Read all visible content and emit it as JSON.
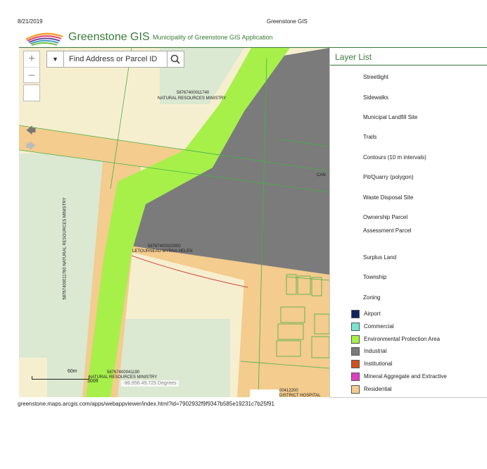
{
  "print": {
    "date": "8/21/2019",
    "title": "Greenstone GIS",
    "url": "greenstone.maps.arcgis.com/apps/webappviewer/index.html?id=7902932f9f9347b585e19231c7b25f91"
  },
  "header": {
    "app_name": "Greenstone GIS",
    "subtitle": "Municipality of Greenstone GIS Application"
  },
  "map": {
    "zoom_in_label": "+",
    "zoom_out_label": "–",
    "back_label": "🡄",
    "forward_label": "🡆",
    "search_placeholder": "Find Address or Parcel ID",
    "labels": {
      "parcel_top_id": "58767400011740",
      "parcel_top_owner": "NATURAL RESOURCES MINISTRY",
      "parcel_left": "58767400011760 NATURAL RESOURCES MINISTRY",
      "parcel_mid_id": "58767400020000",
      "parcel_mid_owner": "LETOURNEAU MYRNA HELEN",
      "parcel_bottom_id": "58767400041190",
      "parcel_bottom_owner": "NATURAL RESOURCES MINISTRY",
      "parcel_br_id": "00412200",
      "parcel_br_owner": "DISTRICT HOSPITAL",
      "canv": "CAN"
    },
    "scale_m": "60m",
    "scale_ft": "300ft",
    "coordinates": "-86.956 49.725 Degrees"
  },
  "layer_list": {
    "title": "Layer List",
    "layers": [
      "Streetlight",
      "Sidewalks",
      "Municipal Landfill Site",
      "Trails",
      "Contours (10 m intervals)",
      "Pit/Quarry (polygon)",
      "Waste Disposal Site",
      "Ownership Parcel",
      "Assessment Parcel",
      "Surplus Land",
      "Township",
      "Zoning"
    ],
    "legend": [
      {
        "label": "Airport",
        "color": "#0f2160"
      },
      {
        "label": "Commercial",
        "color": "#79e3d1"
      },
      {
        "label": "Environmental Protection Area",
        "color": "#a7f04a"
      },
      {
        "label": "Industrial",
        "color": "#7b7b7b"
      },
      {
        "label": "Institutional",
        "color": "#d0521e"
      },
      {
        "label": "Mineral Aggregate and Extractive",
        "color": "#e03ec4"
      },
      {
        "label": "Residential",
        "color": "#f3cc8e"
      }
    ]
  },
  "colors": {
    "brand": "#3a7a3a",
    "residential": "#f3cc8e",
    "industrial": "#7b7b7b",
    "environmental": "#a7f04a",
    "crown_land": "#dbe8d2",
    "base": "#f6efcf"
  }
}
